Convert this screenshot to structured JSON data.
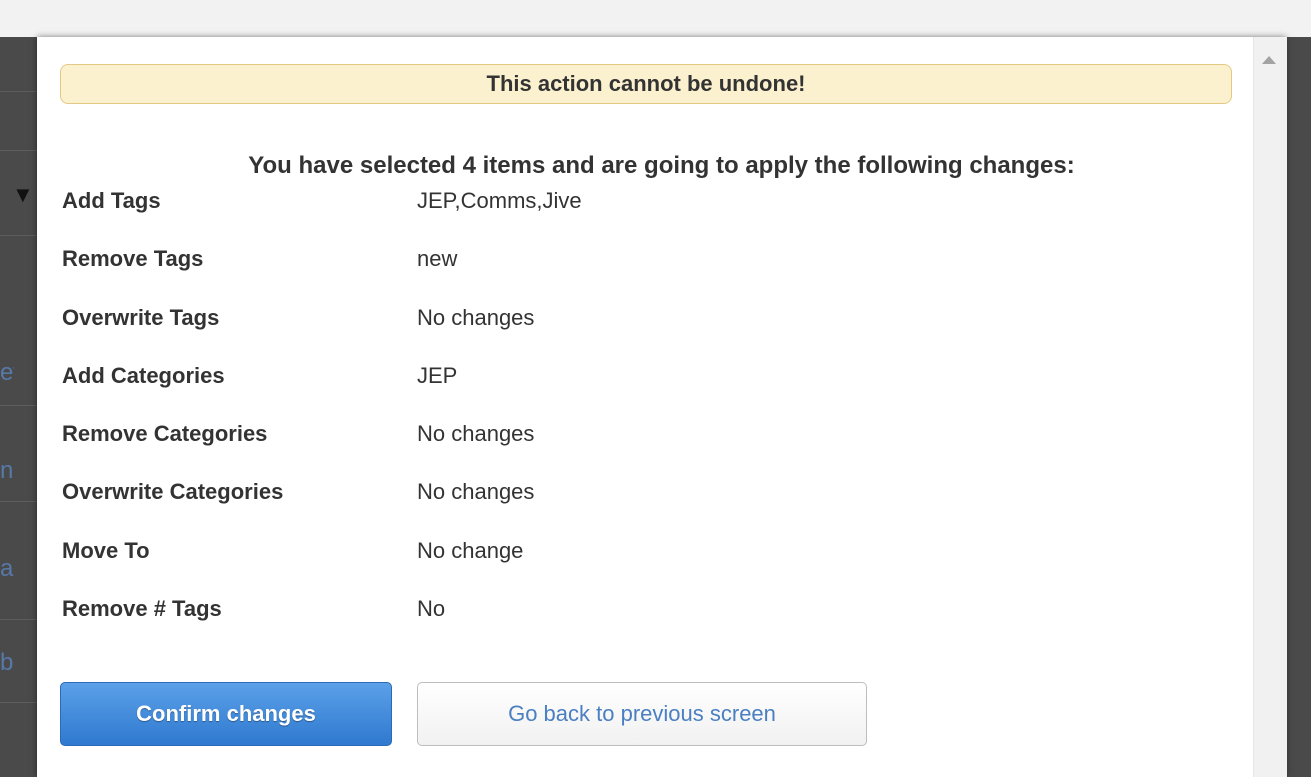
{
  "background_fragments": [
    "ew",
    "nc",
    "ar",
    "bli"
  ],
  "modal": {
    "warning": "This action cannot be undone!",
    "summary": "You have selected 4 items and are going to apply the following changes:",
    "changes": [
      {
        "label": "Add Tags",
        "value": "JEP,Comms,Jive"
      },
      {
        "label": "Remove Tags",
        "value": "new"
      },
      {
        "label": "Overwrite Tags",
        "value": "No changes"
      },
      {
        "label": "Add Categories",
        "value": "JEP"
      },
      {
        "label": "Remove Categories",
        "value": "No changes"
      },
      {
        "label": "Overwrite Categories",
        "value": "No changes"
      },
      {
        "label": "Move To",
        "value": "No change"
      },
      {
        "label": "Remove # Tags",
        "value": "No"
      }
    ],
    "confirm_label": "Confirm changes",
    "back_label": "Go back to previous screen"
  },
  "colors": {
    "primary_button": "#2f79cf",
    "warning_bg": "#fcf1cf",
    "link_text": "#4a7fc1"
  }
}
